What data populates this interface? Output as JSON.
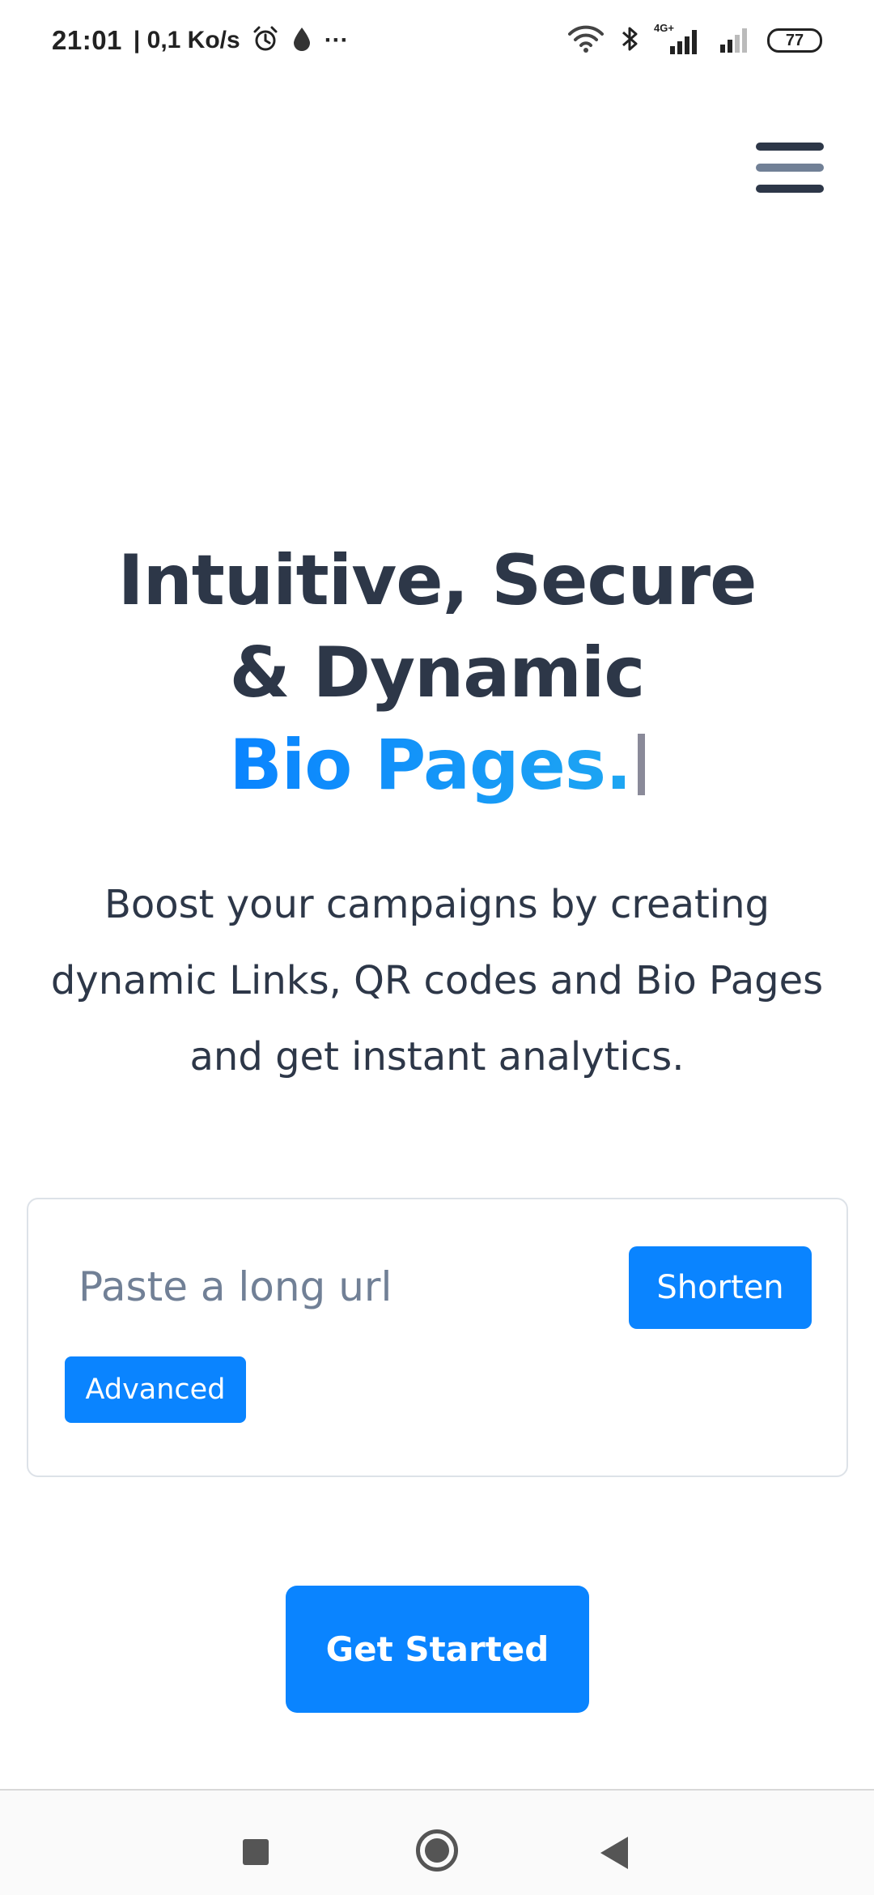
{
  "status_bar": {
    "time": "21:01",
    "network_speed": "| 0,1 Ko/s",
    "more_indicator": "···",
    "network_type": "4G+",
    "battery": "77",
    "icons": [
      "alarm-icon",
      "drop-icon",
      "wifi-icon",
      "bluetooth-icon",
      "signal-icon",
      "battery-icon"
    ]
  },
  "header": {
    "menu_icon": "hamburger-menu-icon"
  },
  "hero": {
    "headline_line1": "Intuitive, Secure",
    "headline_line2": "& Dynamic",
    "headline_accent": "Bio Pages.",
    "subtitle_line1": "Boost your campaigns by creating",
    "subtitle_line2": "dynamic Links, QR codes and Bio Pages",
    "subtitle_line3": "and get instant analytics."
  },
  "shortener": {
    "placeholder": "Paste a long url",
    "value": "",
    "shorten_label": "Shorten",
    "advanced_label": "Advanced"
  },
  "cta": {
    "get_started_label": "Get Started"
  },
  "colors": {
    "primary": "#0a84ff",
    "heading": "#2d3748",
    "placeholder": "#718096",
    "border": "#dde2e8"
  },
  "nav_bar": {
    "icons": [
      "recent-apps-icon",
      "home-icon",
      "back-icon"
    ]
  }
}
